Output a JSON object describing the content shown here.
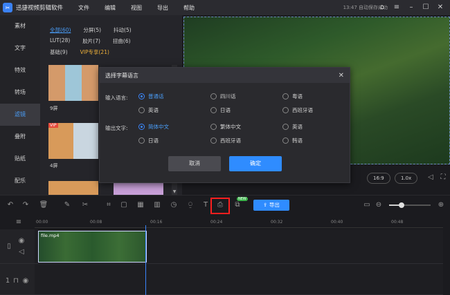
{
  "app": {
    "title": "迅捷视频剪辑软件",
    "logo_glyph": "✂"
  },
  "menu": [
    "文件",
    "编辑",
    "视图",
    "导出",
    "帮助"
  ],
  "status": {
    "autosave": "13:47 自动保存成功"
  },
  "sidebar": {
    "items": [
      "素材",
      "文字",
      "特效",
      "转场",
      "滤镜",
      "叠附",
      "贴纸",
      "配乐"
    ],
    "active_index": 4
  },
  "filter_panel": {
    "categories": [
      [
        "全部(60)",
        "分屏(5)",
        "抖动(5)"
      ],
      [
        "LUT(28)",
        "胶片(7)",
        "扭曲(6)"
      ],
      [
        "基础(9)",
        "VIP专享(21)"
      ]
    ],
    "thumbs": [
      {
        "label": "9屏"
      },
      {
        "label": "4屏"
      }
    ],
    "vip_tag": "VIP"
  },
  "preview": {
    "ratio": "16:9",
    "speed": "1.0x"
  },
  "toolbar": {
    "export_label": "导出",
    "new_badge": "NEW"
  },
  "timeline": {
    "ticks": [
      "00:00",
      "00:08",
      "00:16",
      "00:24",
      "00:32",
      "00:40",
      "00:48"
    ],
    "clip_name": "file.mp4",
    "track_numbers": [
      "1",
      "1"
    ]
  },
  "dialog": {
    "title": "选择字幕语言",
    "input_label": "输入语言:",
    "output_label": "输出文字:",
    "input_options": [
      "普通话",
      "四川话",
      "粤语",
      "英语",
      "日语",
      "西班牙语"
    ],
    "output_options": [
      "简体中文",
      "繁体中文",
      "英语",
      "日语",
      "西班牙语",
      "韩语"
    ],
    "input_selected": "普通话",
    "output_selected": "简体中文",
    "cancel_label": "取消",
    "ok_label": "确定"
  },
  "colors": {
    "accent": "#2f8cff",
    "highlight": "#ff1f1f",
    "vip": "#f0b23a"
  }
}
